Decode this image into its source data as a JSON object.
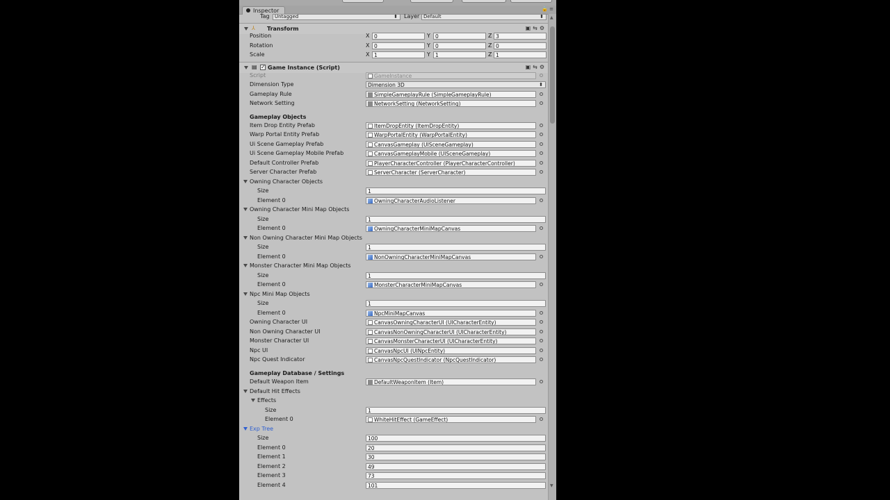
{
  "inspector": {
    "tab_label": "Inspector",
    "tag_label": "Tag",
    "tag_value": "Untagged",
    "layer_label": "Layer",
    "layer_value": "Default"
  },
  "transform": {
    "title": "Transform",
    "rows": [
      {
        "label": "Position",
        "x": "0",
        "y": "0",
        "z": "3"
      },
      {
        "label": "Rotation",
        "x": "0",
        "y": "0",
        "z": "0"
      },
      {
        "label": "Scale",
        "x": "1",
        "y": "1",
        "z": "1"
      }
    ],
    "axis_x": "X",
    "axis_y": "Y",
    "axis_z": "Z"
  },
  "component": {
    "title": "Game Instance (Script)",
    "script_label": "Script",
    "script_value": "GameInstance",
    "dimension_label": "Dimension Type",
    "dimension_value": "Dimension 3D",
    "rule_label": "Gameplay Rule",
    "rule_value": "SimpleGameplayRule (SimpleGameplayRule)",
    "network_label": "Network Setting",
    "network_value": "NetworkSetting (NetworkSetting)"
  },
  "gameplay_objects": {
    "header": "Gameplay Objects",
    "rows": [
      {
        "label": "Item Drop Entity Prefab",
        "value": "ItemDropEntity (ItemDropEntity)"
      },
      {
        "label": "Warp Portal Entity Prefab",
        "value": "WarpPortalEntity (WarpPortalEntity)"
      },
      {
        "label": "Ui Scene Gameplay Prefab",
        "value": "CanvasGameplay (UISceneGameplay)"
      },
      {
        "label": "Ui Scene Gameplay Mobile Prefab",
        "value": "CanvasGameplayMobile (UISceneGameplay)"
      },
      {
        "label": "Default Controller Prefab",
        "value": "PlayerCharacterController (PlayerCharacterController)"
      },
      {
        "label": "Server Character Prefab",
        "value": "ServerCharacter (ServerCharacter)"
      }
    ],
    "size_label": "Size",
    "element0_label": "Element 0",
    "arrays": [
      {
        "label": "Owning Character Objects",
        "size": "1",
        "element": "OwningCharacterAudioListener"
      },
      {
        "label": "Owning Character Mini Map Objects",
        "size": "1",
        "element": "OwningCharacterMiniMapCanvas"
      },
      {
        "label": "Non Owning Character Mini Map Objects",
        "size": "1",
        "element": "NonOwningCharacterMiniMapCanvas"
      },
      {
        "label": "Monster Character Mini Map Objects",
        "size": "1",
        "element": "MonsterCharacterMiniMapCanvas"
      },
      {
        "label": "Npc Mini Map Objects",
        "size": "1",
        "element": "NpcMiniMapCanvas"
      }
    ],
    "ui_rows": [
      {
        "label": "Owning Character UI",
        "value": "CanvasOwningCharacterUI (UICharacterEntity)"
      },
      {
        "label": "Non Owning Character UI",
        "value": "CanvasNonOwningCharacterUI (UICharacterEntity)"
      },
      {
        "label": "Monster Character UI",
        "value": "CanvasMonsterCharacterUI (UICharacterEntity)"
      },
      {
        "label": "Npc UI",
        "value": "CanvasNpcUI (UINpcEntity)"
      },
      {
        "label": "Npc Quest Indicator",
        "value": "CanvasNpcQuestIndicator (NpcQuestIndicator)"
      }
    ]
  },
  "database": {
    "header": "Gameplay Database / Settings",
    "weapon_label": "Default Weapon Item",
    "weapon_value": "DefaultWeaponItem (Item)",
    "hit_label": "Default Hit Effects",
    "effects_label": "Effects",
    "effects_size": "1",
    "effects_element": "WhiteHitEffect (GameEffect)",
    "exp_label": "Exp Tree",
    "exp_size": "100",
    "exp_elements": [
      {
        "label": "Element 0",
        "value": "20"
      },
      {
        "label": "Element 1",
        "value": "30"
      },
      {
        "label": "Element 2",
        "value": "49"
      },
      {
        "label": "Element 3",
        "value": "73"
      },
      {
        "label": "Element 4",
        "value": "101"
      }
    ]
  }
}
